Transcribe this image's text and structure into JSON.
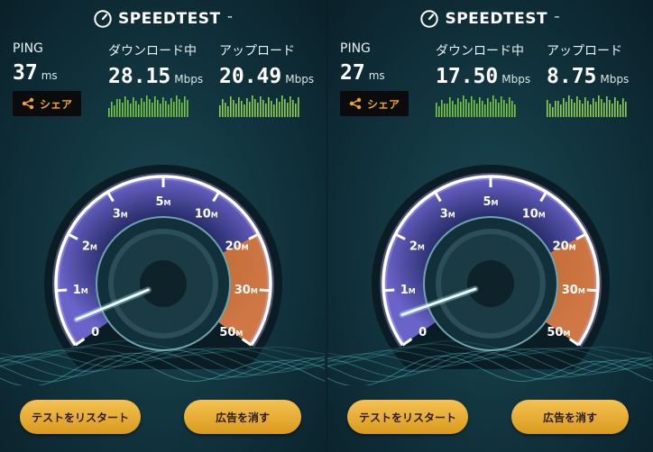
{
  "panels": [
    {
      "brand": "SPEEDTEST",
      "ping": {
        "label": "PING",
        "value": "37",
        "unit": "ms"
      },
      "download": {
        "label": "ダウンロード中",
        "value": "28.15",
        "unit": "Mbps"
      },
      "upload": {
        "label": "アップロード",
        "value": "20.49",
        "unit": "Mbps"
      },
      "share_label": "シェア",
      "scale": [
        "0",
        "1M",
        "2M",
        "3M",
        "5M",
        "10M",
        "20M",
        "30M",
        "50M"
      ],
      "needle_value_mbps": 0.4,
      "restart_label": "テストをリスタート",
      "remove_ads_label": "広告を消す"
    },
    {
      "brand": "SPEEDTEST",
      "ping": {
        "label": "PING",
        "value": "27",
        "unit": "ms"
      },
      "download": {
        "label": "ダウンロード中",
        "value": "17.50",
        "unit": "Mbps"
      },
      "upload": {
        "label": "アップロード",
        "value": "8.75",
        "unit": "Mbps"
      },
      "share_label": "シェア",
      "scale": [
        "0",
        "1M",
        "2M",
        "3M",
        "5M",
        "10M",
        "20M",
        "30M",
        "50M"
      ],
      "needle_value_mbps": 0.5,
      "restart_label": "テストをリスタート",
      "remove_ads_label": "広告を消す"
    }
  ],
  "colors": {
    "accent": "#f5a623",
    "dial_outer": "#ffffff",
    "dial_fill": "#3b3f8f",
    "hot_zone": "#e07a2e",
    "bars_download": "#7ac943",
    "bars_upload": "#8fd14f"
  }
}
